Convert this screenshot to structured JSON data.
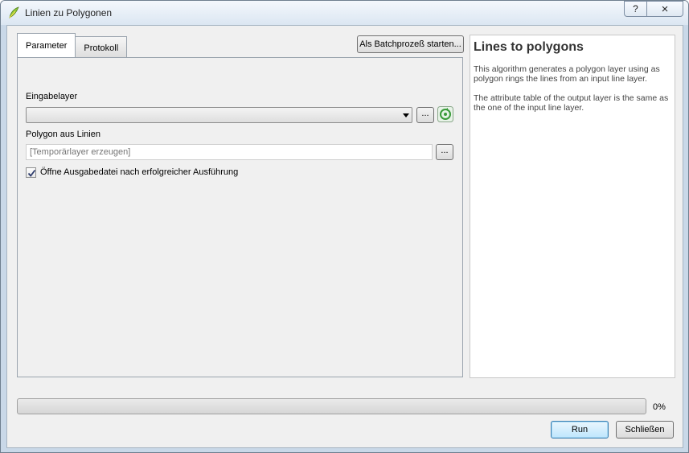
{
  "window": {
    "title": "Linien zu Polygonen",
    "icon": "qgis-icon",
    "help_button": "?",
    "close_button": "×"
  },
  "tabs": [
    {
      "label": "Parameter",
      "active": true
    },
    {
      "label": "Protokoll",
      "active": false
    }
  ],
  "batch_button": "Als Batchprozeß starten...",
  "params": {
    "input_label": "Eingabelayer",
    "input_value": "",
    "browse_label": "...",
    "output_label": "Polygon aus Linien",
    "output_placeholder": "[Temporärlayer erzeugen]",
    "output_browse_label": "...",
    "open_output_label": "Öffne Ausgabedatei nach erfolgreicher Ausführung",
    "open_output_checked": true
  },
  "help": {
    "title": "Lines to polygons",
    "paragraphs": [
      "This algorithm generates a polygon layer using as polygon rings the lines from an input line layer.",
      "The attribute table of the output layer is the same as the one of the input line layer."
    ]
  },
  "progress": {
    "value": 0,
    "label": "0%"
  },
  "buttons": {
    "run": "Run",
    "close": "Schließen"
  },
  "colors": {
    "progress_fill": "#3fbf3f",
    "iterate_icon": "#3a9a3a"
  }
}
